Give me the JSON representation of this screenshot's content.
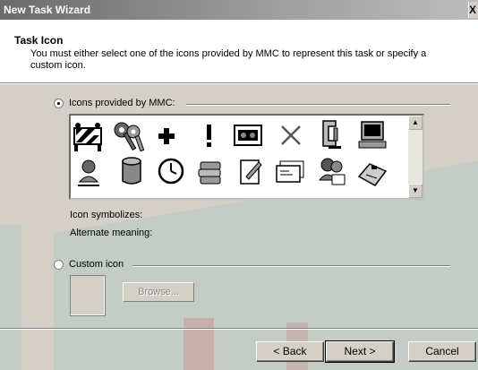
{
  "window": {
    "title": "New Task Wizard",
    "close_glyph": "X"
  },
  "header": {
    "title": "Task Icon",
    "description": "You must either select one of the icons provided by MMC to represent this task or specify a custom icon."
  },
  "mmc_option": {
    "label": "Icons provided by MMC:",
    "selected": true
  },
  "icons": [
    "construction-barrier-icon",
    "keys-icon",
    "plus-icon",
    "exclamation-icon",
    "tape-drive-icon",
    "x-mark-icon",
    "clamp-icon",
    "computer-icon",
    "network-user-icon",
    "database-cylinder-icon",
    "clock-icon",
    "stacked-disks-icon",
    "note-pencil-icon",
    "envelopes-icon",
    "users-mail-icon",
    "fax-machine-icon"
  ],
  "info": {
    "symbolizes_label": "Icon symbolizes:",
    "alternate_label": "Alternate meaning:"
  },
  "custom_option": {
    "label": "Custom icon",
    "selected": false,
    "browse_label": "Browse..."
  },
  "footer": {
    "back_label": "< Back",
    "next_label": "Next >",
    "cancel_label": "Cancel"
  },
  "colors": {
    "watermark_teal": "#5cbfc2",
    "watermark_red": "#d8434b",
    "dialog_bg": "#d4d0c8"
  }
}
